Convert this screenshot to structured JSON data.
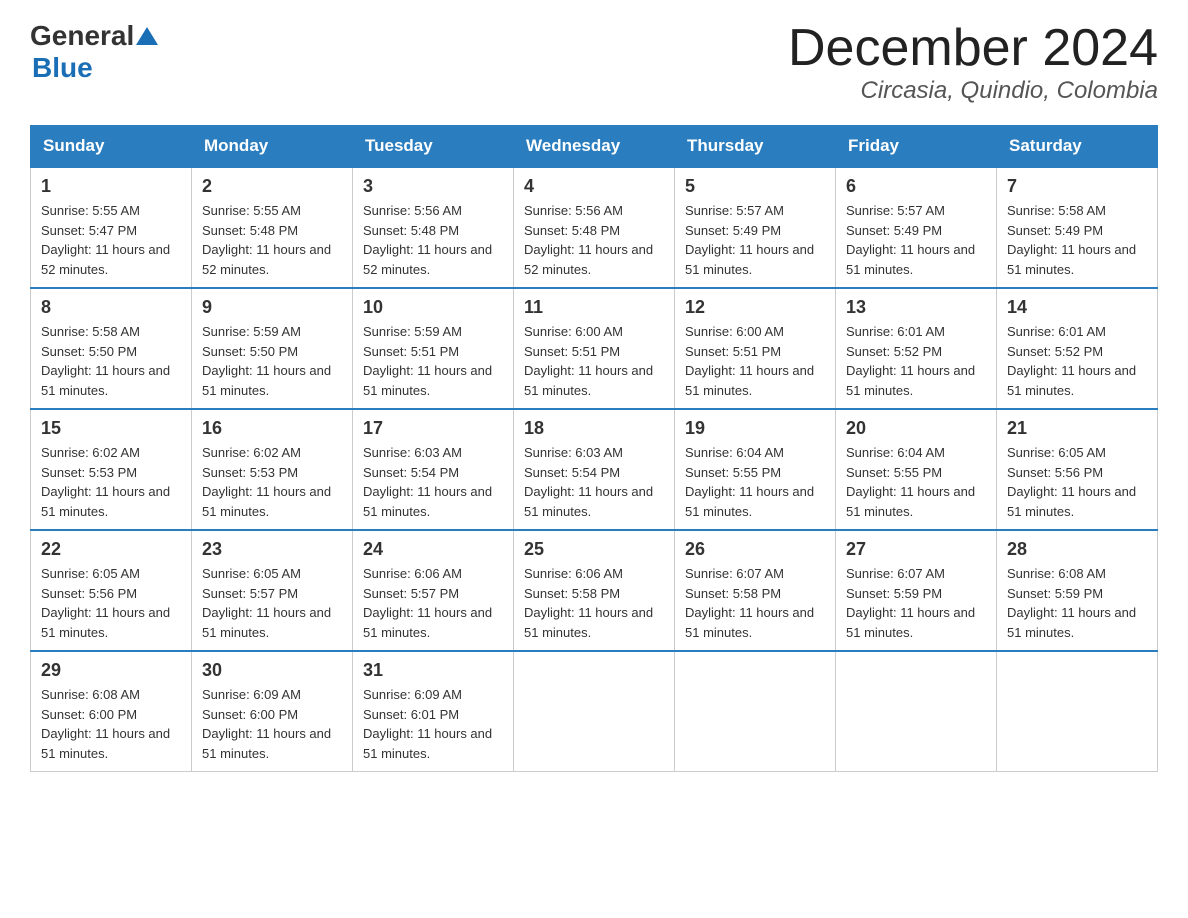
{
  "header": {
    "logo_general": "General",
    "logo_blue": "Blue",
    "month_title": "December 2024",
    "location": "Circasia, Quindio, Colombia"
  },
  "days_of_week": [
    "Sunday",
    "Monday",
    "Tuesday",
    "Wednesday",
    "Thursday",
    "Friday",
    "Saturday"
  ],
  "weeks": [
    [
      {
        "day": "1",
        "sunrise": "5:55 AM",
        "sunset": "5:47 PM",
        "daylight": "11 hours and 52 minutes."
      },
      {
        "day": "2",
        "sunrise": "5:55 AM",
        "sunset": "5:48 PM",
        "daylight": "11 hours and 52 minutes."
      },
      {
        "day": "3",
        "sunrise": "5:56 AM",
        "sunset": "5:48 PM",
        "daylight": "11 hours and 52 minutes."
      },
      {
        "day": "4",
        "sunrise": "5:56 AM",
        "sunset": "5:48 PM",
        "daylight": "11 hours and 52 minutes."
      },
      {
        "day": "5",
        "sunrise": "5:57 AM",
        "sunset": "5:49 PM",
        "daylight": "11 hours and 51 minutes."
      },
      {
        "day": "6",
        "sunrise": "5:57 AM",
        "sunset": "5:49 PM",
        "daylight": "11 hours and 51 minutes."
      },
      {
        "day": "7",
        "sunrise": "5:58 AM",
        "sunset": "5:49 PM",
        "daylight": "11 hours and 51 minutes."
      }
    ],
    [
      {
        "day": "8",
        "sunrise": "5:58 AM",
        "sunset": "5:50 PM",
        "daylight": "11 hours and 51 minutes."
      },
      {
        "day": "9",
        "sunrise": "5:59 AM",
        "sunset": "5:50 PM",
        "daylight": "11 hours and 51 minutes."
      },
      {
        "day": "10",
        "sunrise": "5:59 AM",
        "sunset": "5:51 PM",
        "daylight": "11 hours and 51 minutes."
      },
      {
        "day": "11",
        "sunrise": "6:00 AM",
        "sunset": "5:51 PM",
        "daylight": "11 hours and 51 minutes."
      },
      {
        "day": "12",
        "sunrise": "6:00 AM",
        "sunset": "5:51 PM",
        "daylight": "11 hours and 51 minutes."
      },
      {
        "day": "13",
        "sunrise": "6:01 AM",
        "sunset": "5:52 PM",
        "daylight": "11 hours and 51 minutes."
      },
      {
        "day": "14",
        "sunrise": "6:01 AM",
        "sunset": "5:52 PM",
        "daylight": "11 hours and 51 minutes."
      }
    ],
    [
      {
        "day": "15",
        "sunrise": "6:02 AM",
        "sunset": "5:53 PM",
        "daylight": "11 hours and 51 minutes."
      },
      {
        "day": "16",
        "sunrise": "6:02 AM",
        "sunset": "5:53 PM",
        "daylight": "11 hours and 51 minutes."
      },
      {
        "day": "17",
        "sunrise": "6:03 AM",
        "sunset": "5:54 PM",
        "daylight": "11 hours and 51 minutes."
      },
      {
        "day": "18",
        "sunrise": "6:03 AM",
        "sunset": "5:54 PM",
        "daylight": "11 hours and 51 minutes."
      },
      {
        "day": "19",
        "sunrise": "6:04 AM",
        "sunset": "5:55 PM",
        "daylight": "11 hours and 51 minutes."
      },
      {
        "day": "20",
        "sunrise": "6:04 AM",
        "sunset": "5:55 PM",
        "daylight": "11 hours and 51 minutes."
      },
      {
        "day": "21",
        "sunrise": "6:05 AM",
        "sunset": "5:56 PM",
        "daylight": "11 hours and 51 minutes."
      }
    ],
    [
      {
        "day": "22",
        "sunrise": "6:05 AM",
        "sunset": "5:56 PM",
        "daylight": "11 hours and 51 minutes."
      },
      {
        "day": "23",
        "sunrise": "6:05 AM",
        "sunset": "5:57 PM",
        "daylight": "11 hours and 51 minutes."
      },
      {
        "day": "24",
        "sunrise": "6:06 AM",
        "sunset": "5:57 PM",
        "daylight": "11 hours and 51 minutes."
      },
      {
        "day": "25",
        "sunrise": "6:06 AM",
        "sunset": "5:58 PM",
        "daylight": "11 hours and 51 minutes."
      },
      {
        "day": "26",
        "sunrise": "6:07 AM",
        "sunset": "5:58 PM",
        "daylight": "11 hours and 51 minutes."
      },
      {
        "day": "27",
        "sunrise": "6:07 AM",
        "sunset": "5:59 PM",
        "daylight": "11 hours and 51 minutes."
      },
      {
        "day": "28",
        "sunrise": "6:08 AM",
        "sunset": "5:59 PM",
        "daylight": "11 hours and 51 minutes."
      }
    ],
    [
      {
        "day": "29",
        "sunrise": "6:08 AM",
        "sunset": "6:00 PM",
        "daylight": "11 hours and 51 minutes."
      },
      {
        "day": "30",
        "sunrise": "6:09 AM",
        "sunset": "6:00 PM",
        "daylight": "11 hours and 51 minutes."
      },
      {
        "day": "31",
        "sunrise": "6:09 AM",
        "sunset": "6:01 PM",
        "daylight": "11 hours and 51 minutes."
      },
      null,
      null,
      null,
      null
    ]
  ],
  "labels": {
    "sunrise": "Sunrise:",
    "sunset": "Sunset:",
    "daylight": "Daylight:"
  }
}
